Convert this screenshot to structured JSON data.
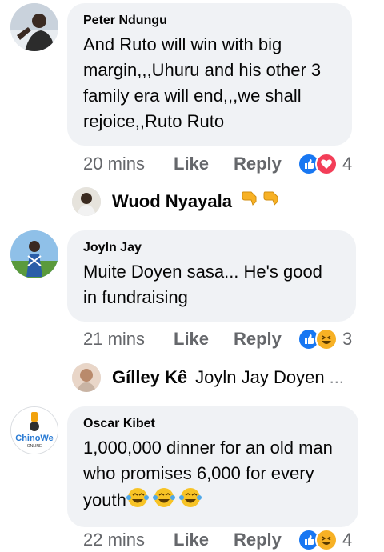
{
  "comments": [
    {
      "author": "Peter Ndungu",
      "text": "And Ruto will win with big margin,,,Uhuru and his other 3 family era will end,,,we shall rejoice,,Ruto Ruto",
      "time": "20 mins",
      "like_label": "Like",
      "reply_label": "Reply",
      "reactions": [
        "like",
        "love"
      ],
      "reaction_count": "4",
      "reply_preview": {
        "name": "Wuod Nyayala",
        "text": "",
        "emoji": "pointing-down-hands-icon"
      }
    },
    {
      "author": "Joyln Jay",
      "text": "Muite Doyen sasa... He's good in fundraising",
      "time": "21 mins",
      "like_label": "Like",
      "reply_label": "Reply",
      "reactions": [
        "like",
        "haha"
      ],
      "reaction_count": "3",
      "reply_preview": {
        "name": "Gílley Kê",
        "text": "Joyln Jay Doyen",
        "ellipsis": "..."
      }
    },
    {
      "author": "Oscar Kibet",
      "text": "1,000,000 dinner for an old man who promises 6,000 for every youth",
      "time": "22 mins",
      "like_label": "Like",
      "reply_label": "Reply",
      "reactions": [
        "like",
        "haha"
      ],
      "reaction_count": "4",
      "logo_text": {
        "line1": "ChinoWe",
        "line2": "ONLINE"
      }
    }
  ],
  "colors": {
    "bubble": "#f0f2f5",
    "meta": "#65676b",
    "like_blue": "#1877f2",
    "love_red": "#f33e58",
    "haha_yellow": "#f7b125"
  }
}
